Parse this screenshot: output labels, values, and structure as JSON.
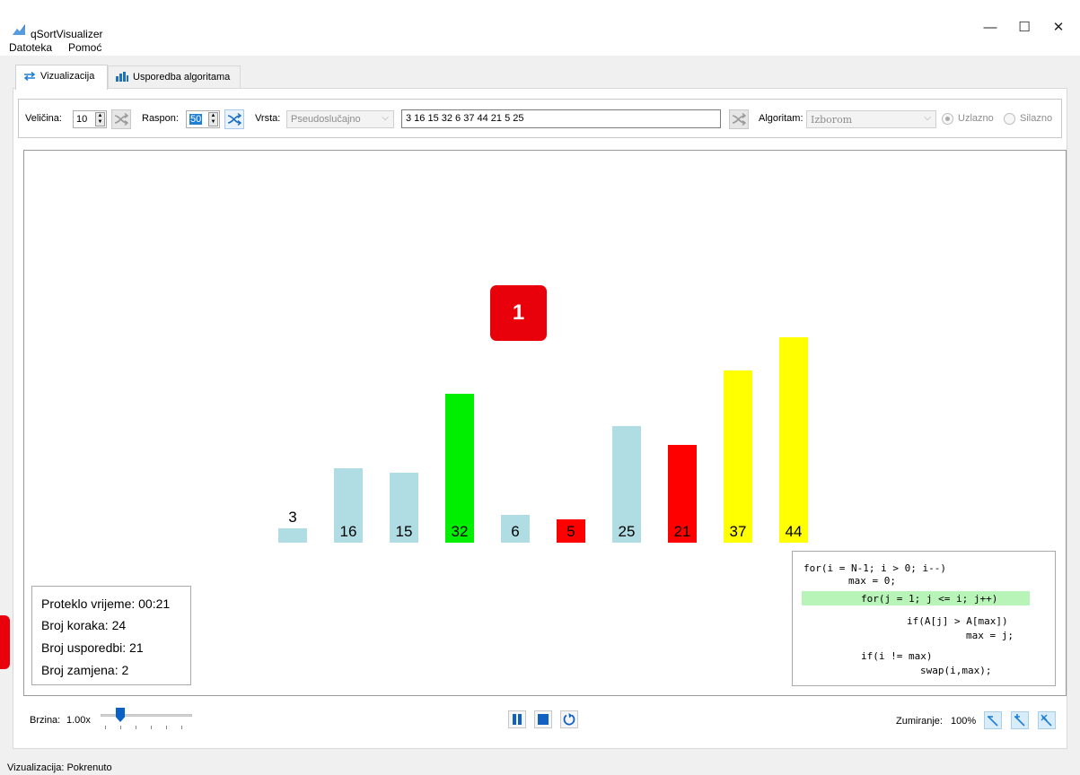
{
  "window": {
    "title": "qSortVisualizer",
    "minimize": "—",
    "maximize": "☐",
    "close": "✕"
  },
  "menu": {
    "items": [
      "Datoteka",
      "Pomoć"
    ]
  },
  "tabs": [
    {
      "label": "Vizualizacija",
      "icon": "swap-arrows-icon",
      "active": true
    },
    {
      "label": "Usporedba algoritama",
      "icon": "bar-chart-icon",
      "active": false
    }
  ],
  "controls": {
    "size_label": "Veličina:",
    "size_value": "10",
    "range_label": "Raspon:",
    "range_value": "50",
    "type_label": "Vrsta:",
    "type_value": "Pseudoslučajno",
    "sequence": "3 16 15 32 6 37 44 21 5 25",
    "algorithm_label": "Algoritam:",
    "algorithm_value": "Izborom",
    "order_asc": "Uzlazno",
    "order_desc": "Silazno",
    "order_selected": "Uzlazno"
  },
  "visualization": {
    "marker_label": "1",
    "bars": [
      {
        "value": "3",
        "color": "#b0dde4",
        "state": "unsorted"
      },
      {
        "value": "16",
        "color": "#b0dde4",
        "state": "unsorted"
      },
      {
        "value": "15",
        "color": "#b0dde4",
        "state": "unsorted"
      },
      {
        "value": "32",
        "color": "#00ee00",
        "state": "current-max"
      },
      {
        "value": "6",
        "color": "#b0dde4",
        "state": "unsorted"
      },
      {
        "value": "5",
        "color": "#ff0000",
        "state": "comparing"
      },
      {
        "value": "25",
        "color": "#b0dde4",
        "state": "unsorted"
      },
      {
        "value": "21",
        "color": "#ff0000",
        "state": "comparing"
      },
      {
        "value": "37",
        "color": "#ffff00",
        "state": "sorted"
      },
      {
        "value": "44",
        "color": "#ffff00",
        "state": "sorted"
      }
    ]
  },
  "stats": {
    "elapsed": "Proteklo vrijeme: 00:21",
    "steps": "Broj koraka: 24",
    "comparisons": "Broj usporedbi: 21",
    "swaps": "Broj zamjena: 2"
  },
  "code": {
    "lines": [
      "for(i = N-1; i > 0; i--)",
      "max = 0;",
      "for(j = 1; j <= i; j++)",
      "if(A[j] > A[max])",
      "max = j;",
      "if(i != max)",
      "swap(i,max);"
    ],
    "highlight_color": "#b8f4b8"
  },
  "playback": {
    "speed_label": "Brzina:",
    "speed_value": "1.00x",
    "zoom_label": "Zumiranje:",
    "zoom_value": "100%"
  },
  "statusbar": {
    "text": "Vizualizacija: Pokrenuto"
  }
}
